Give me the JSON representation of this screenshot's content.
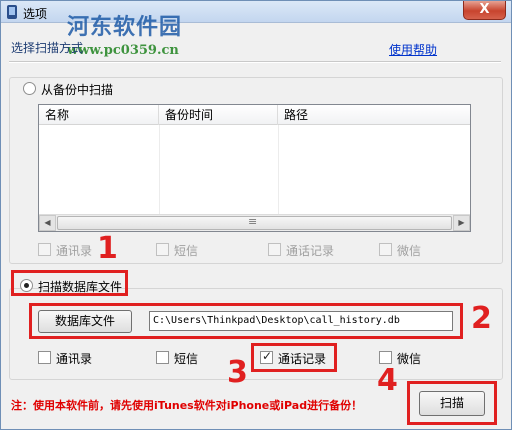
{
  "window": {
    "title": "选项",
    "close_label": "X"
  },
  "watermark": {
    "logo_text": "河东软件园",
    "url_text": "www.pc0359.cn"
  },
  "header": {
    "section_label": "选择扫描方式",
    "help_link": "使用帮助"
  },
  "backup_scan": {
    "radio_label": "从备份中扫描",
    "columns": [
      "名称",
      "备份时间",
      "路径"
    ],
    "checkboxes": [
      "通讯录",
      "短信",
      "通话记录",
      "微信"
    ]
  },
  "db_scan": {
    "radio_label": "扫描数据库文件",
    "browse_button": "数据库文件",
    "path_value": "C:\\Users\\Thinkpad\\Desktop\\call_history.db",
    "checkboxes": [
      "通讯录",
      "短信",
      "通话记录",
      "微信"
    ]
  },
  "footer": {
    "note": "注：使用本软件前，请先使用iTunes软件对iPhone或iPad进行备份！",
    "scan_button": "扫描"
  },
  "annotations": [
    "1",
    "2",
    "3",
    "4"
  ],
  "colors": {
    "accent": "#e02020",
    "link": "#0033cc"
  },
  "icons": [
    "app-icon",
    "close-icon",
    "scroll-left-arrow-icon",
    "scroll-right-arrow-icon"
  ]
}
